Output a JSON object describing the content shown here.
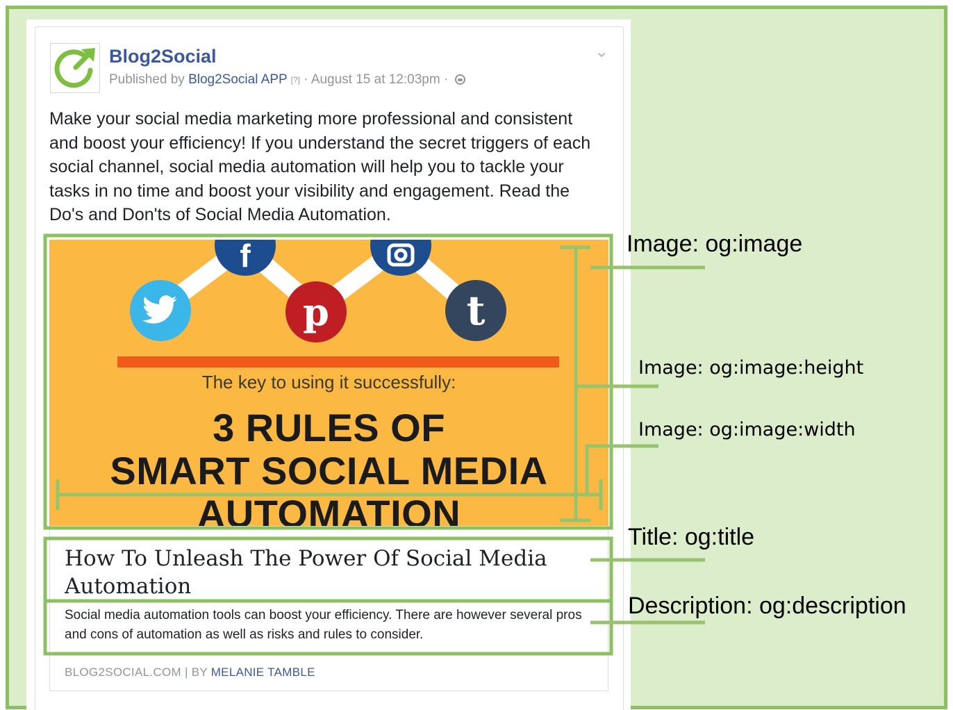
{
  "post": {
    "page_name": "Blog2Social",
    "published_by": "Published by",
    "app_name": "Blog2Social APP",
    "help_mark": "[?]",
    "timestamp": "· August 15 at 12:03pm ·",
    "text": "Make your social media marketing more professional and consistent and boost your efficiency! If you understand the secret triggers of each social channel, social media automation will help you to tackle your tasks in no time and boost your visibility and engagement. Read the Do's and Don'ts of Social Media Automation."
  },
  "image": {
    "tagline": "The key to using it successfully:",
    "heading_line1": "3 RULES OF",
    "heading_line2": "SMART SOCIAL MEDIA",
    "heading_line3": "AUTOMATION"
  },
  "link": {
    "title": "How To Unleash The Power Of Social Media Automation",
    "description": "Social media automation tools can boost your efficiency. There are however several pros and cons of automation as well as risks and rules to consider.",
    "domain": "BLOG2SOCIAL.COM",
    "separator": "| BY",
    "author": "MELANIE TAMBLE"
  },
  "annotations": {
    "image": "Image: og:image",
    "height": "Image: og:image:height",
    "width": "Image: og:image:width",
    "title": "Title: og:title",
    "description": "Description: og:description"
  },
  "colors": {
    "annotation_green": "#8cc063",
    "background_green": "#dcedcc",
    "facebook_blue": "#3b5998",
    "image_orange": "#fbb843"
  },
  "icons": [
    "blog2social-logo-icon",
    "chevron-down-icon",
    "globe-icon",
    "twitter-icon",
    "facebook-icon",
    "pinterest-icon",
    "instagram-icon",
    "tumblr-icon"
  ]
}
